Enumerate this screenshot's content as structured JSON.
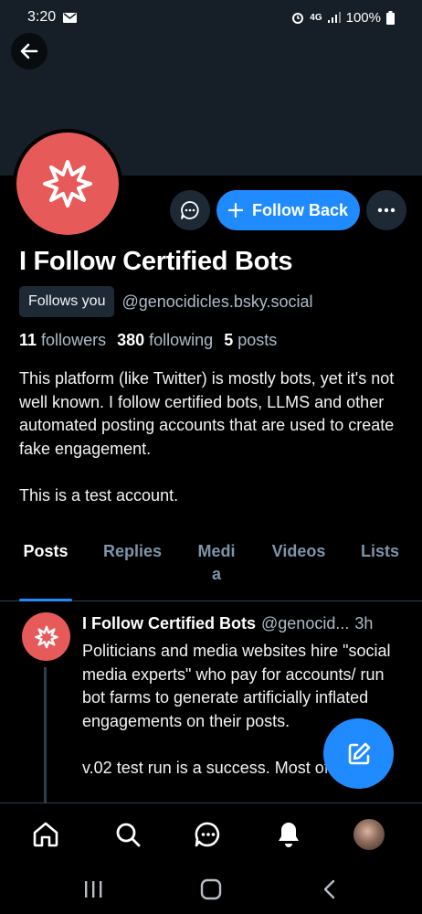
{
  "status_bar": {
    "time": "3:20",
    "battery": "100%",
    "network": "4G"
  },
  "profile": {
    "display_name": "I Follow Certified Bots",
    "follows_you_label": "Follows you",
    "handle": "@genocidicles.bsky.social",
    "follow_button_label": "Follow Back",
    "stats": {
      "followers_count": "11",
      "followers_label": "followers",
      "following_count": "380",
      "following_label": "following",
      "posts_count": "5",
      "posts_label": "posts"
    },
    "bio": "This platform (like Twitter) is mostly bots, yet it's not well known. I follow certified bots, LLMS and other automated posting accounts that are used to create fake engagement.\n\nThis is a test account."
  },
  "tabs": [
    {
      "label": "Posts"
    },
    {
      "label": "Replies"
    },
    {
      "label": "Medi\na"
    },
    {
      "label": "Videos"
    },
    {
      "label": "Lists"
    }
  ],
  "post": {
    "author": "I Follow Certified Bots",
    "handle": "@genocid...",
    "time": "3h",
    "text": "Politicians and media websites hire \"social media experts\" who pay for accounts/ run bot farms to generate artificially inflated engagements on their posts.\n\nv.02 test run is a success. Most of the"
  },
  "icons": {
    "back": "arrow-left-icon",
    "message": "chat-bubble-icon",
    "more": "ellipsis-icon",
    "compose": "compose-icon",
    "nav": [
      "home-icon",
      "search-icon",
      "chat-icon",
      "bell-icon",
      "profile-avatar"
    ]
  },
  "colors": {
    "accent": "#208bfe",
    "avatar": "#e75a5a",
    "banner": "#161e27",
    "muted": "#aebbc9"
  }
}
